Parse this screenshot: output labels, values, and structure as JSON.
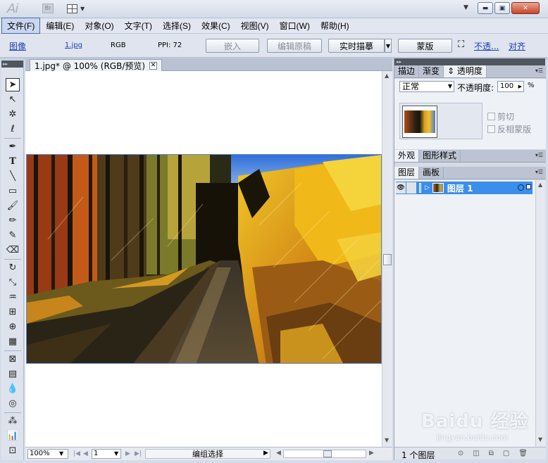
{
  "app": {
    "logo": "Ai",
    "bridge_logo": "Br",
    "window_controls": [
      "minimize-icon",
      "restore-icon",
      "close-icon"
    ]
  },
  "menu": [
    "文件(F)",
    "编辑(E)",
    "对象(O)",
    "文字(T)",
    "选择(S)",
    "效果(C)",
    "视图(V)",
    "窗口(W)",
    "帮助(H)"
  ],
  "control_bar": {
    "object_type": "图像",
    "file_name": "1.jpg",
    "color_mode": "RGB",
    "ppi": "PPI: 72",
    "embed": "嵌入",
    "edit_original": "编辑原稿",
    "live_trace": "实时描摹",
    "mask": "蒙版",
    "opacity_link": "不透...",
    "align_link": "对齐"
  },
  "document": {
    "tab_title": "1.jpg* @ 100% (RGB/预览)"
  },
  "status_bar": {
    "zoom": "100%",
    "artboard": "1",
    "status_text": "编组选择"
  },
  "panels": {
    "transparency_tabs": [
      "描边",
      "渐变",
      "透明度"
    ],
    "active_transparency_tab": "透明度",
    "blend_mode": "正常",
    "opacity_label": "不透明度:",
    "opacity_value": "100",
    "opacity_unit": "%",
    "clip_label": "剪切",
    "invert_mask_label": "反相蒙版",
    "appearance_tabs": [
      "外观",
      "图形样式"
    ],
    "layers_tabs": [
      "图层",
      "画板"
    ],
    "layer_name": "图层 1",
    "layer_count": "1 个图层"
  },
  "watermark": {
    "main": "Baidu 经验",
    "sub": "jingyan.baidu.com"
  },
  "colors": {
    "accent": "#3b8eea",
    "link": "#1a3fb5",
    "close_button": "#c7452a"
  }
}
